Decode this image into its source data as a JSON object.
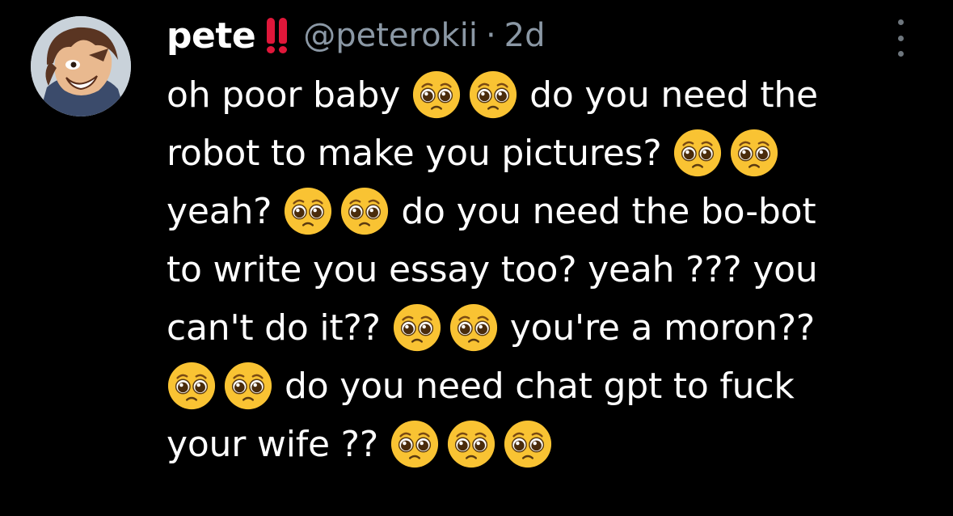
{
  "tweet": {
    "display_name": "pete",
    "badge_icon": "double-exclamation-icon",
    "handle": "@peterokii",
    "separator": "·",
    "time": "2d",
    "more_icon": "vertical-ellipsis-icon",
    "emoji_icon": "pleading-face-icon",
    "lines": [
      {
        "a": "oh poor baby",
        "b": "do you need the"
      },
      {
        "a": "robot to make you pictures?"
      },
      {
        "a": "yeah?",
        "b": "do you need the bo-bot"
      },
      {
        "a": "to write you essay too? yeah ??? you"
      },
      {
        "a": "can't do it??",
        "b": "you're a moron??"
      },
      {
        "b": "do you need chat gpt to fuck"
      },
      {
        "a": "your wife ??"
      }
    ]
  },
  "colors": {
    "background": "#000000",
    "text": "#ffffff",
    "secondary": "#8b98a5",
    "badge": "#e0173a",
    "emoji_face": "#f9c333"
  }
}
